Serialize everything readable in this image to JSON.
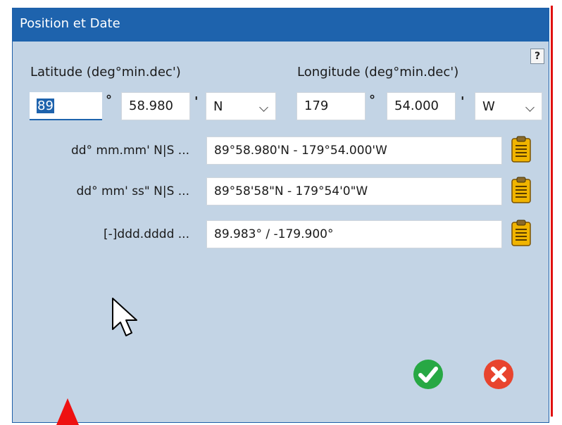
{
  "window": {
    "title": "Position et Date",
    "help_label": "?"
  },
  "latitude": {
    "label": "Latitude (deg°min.dec')",
    "degrees": "89",
    "deg_symbol": "°",
    "minutes": "58.980",
    "min_symbol": "'",
    "hemisphere": "N"
  },
  "longitude": {
    "label": "Longitude (deg°min.dec')",
    "degrees": "179",
    "deg_symbol": "°",
    "minutes": "54.000",
    "min_symbol": "'",
    "hemisphere": "W"
  },
  "formats": [
    {
      "label": "dd° mm.mm' N|S ...",
      "value": "89°58.980'N - 179°54.000'W"
    },
    {
      "label": "dd° mm' ss\" N|S ...",
      "value": "89°58'58\"N - 179°54'0\"W"
    },
    {
      "label": "[-]ddd.dddd ...",
      "value": "89.983° / -179.900°"
    }
  ],
  "colors": {
    "accent": "#1e63ad",
    "ok": "#27a844",
    "cancel": "#e8442e",
    "clipboard": "#f0b400"
  }
}
